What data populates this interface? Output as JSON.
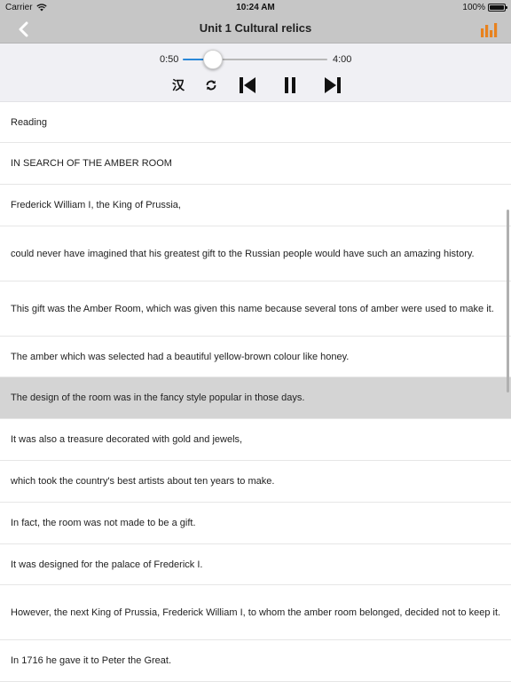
{
  "status_bar": {
    "carrier": "Carrier",
    "time": "10:24 AM",
    "battery": "100%"
  },
  "nav": {
    "title": "Unit 1 Cultural relics",
    "back_icon": "chevron-left-icon",
    "right_icon": "equalizer-icon",
    "accent": "#e8821e"
  },
  "player": {
    "current_time": "0:50",
    "total_time": "4:00",
    "progress": 0.21,
    "lang_toggle": "汉",
    "slider_color": "#2a88d8",
    "icons": [
      "translate-toggle",
      "repeat-icon",
      "skip-previous-icon",
      "pause-icon",
      "skip-next-icon"
    ]
  },
  "sentences": [
    {
      "text": "Reading",
      "selected": false
    },
    {
      "text": "IN SEARCH OF THE AMBER ROOM",
      "selected": false
    },
    {
      "text": "Frederick William I, the King of Prussia,",
      "selected": false
    },
    {
      "text": "could never have imagined that his greatest gift to the Russian people would have such an amazing history.",
      "selected": false
    },
    {
      "text": "This gift was the Amber Room, which was given this name because several tons of amber were used to make it.",
      "selected": false
    },
    {
      "text": "The amber which was selected had a beautiful yellow-brown colour like honey.",
      "selected": false
    },
    {
      "text": "The design of the room was in the fancy style popular in those days.",
      "selected": true
    },
    {
      "text": "It was also a treasure decorated with gold and jewels,",
      "selected": false
    },
    {
      "text": "which took the country's best artists about ten years to make.",
      "selected": false
    },
    {
      "text": "In fact, the room was not made to be a gift.",
      "selected": false
    },
    {
      "text": "It was designed for the palace of Frederick I.",
      "selected": false
    },
    {
      "text": "However, the next King of Prussia, Frederick William I, to whom the amber room belonged, decided not to keep it.",
      "selected": false
    },
    {
      "text": "In 1716 he gave it to Peter the Great.",
      "selected": false
    }
  ]
}
